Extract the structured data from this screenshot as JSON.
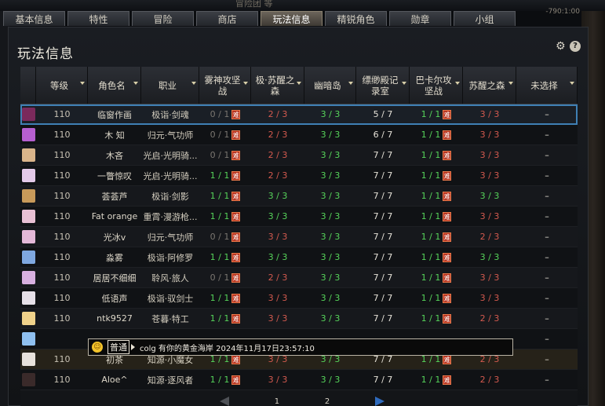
{
  "window": {
    "title": "冒险团 等",
    "clock": "-790:1:00"
  },
  "tabs": [
    {
      "label": "基本信息",
      "active": false
    },
    {
      "label": "特性",
      "active": false
    },
    {
      "label": "冒险",
      "active": false
    },
    {
      "label": "商店",
      "active": false
    },
    {
      "label": "玩法信息",
      "active": true
    },
    {
      "label": "精锐角色",
      "active": false
    },
    {
      "label": "勋章",
      "active": false
    },
    {
      "label": "小组",
      "active": false
    }
  ],
  "panel": {
    "title": "玩法信息",
    "settings_icon": "gear-icon",
    "help_icon": "help-icon",
    "help_label": "?"
  },
  "columns": [
    "等级",
    "角色名",
    "职业",
    "雾神攻坚战",
    "极·苏醒之森",
    "幽暗岛",
    "缥缈殿记录室",
    "巴卡尔攻坚战",
    "苏醒之森",
    "未选择"
  ],
  "hard_badge": "难",
  "rows": [
    {
      "avatar_color": "#7a2a5c",
      "level": "110",
      "name": "临窗作画",
      "job": "极诣·剑魂",
      "c1": "0 / 1",
      "c1c": "dim",
      "c1h": true,
      "c2": "2 / 3",
      "c2c": "red",
      "c3": "3 / 3",
      "c3c": "grn",
      "c4": "5 / 7",
      "c4c": "wht",
      "c5": "1 / 1",
      "c5c": "grn",
      "c5h": true,
      "c6": "3 / 3",
      "c6c": "red",
      "c7": "–",
      "selected": true
    },
    {
      "avatar_color": "#b65fd0",
      "level": "110",
      "name": "木  知",
      "job": "归元·气功师",
      "c1": "0 / 1",
      "c1c": "dim",
      "c1h": true,
      "c2": "2 / 3",
      "c2c": "red",
      "c3": "3 / 3",
      "c3c": "grn",
      "c4": "6 / 7",
      "c4c": "wht",
      "c5": "1 / 1",
      "c5c": "grn",
      "c5h": true,
      "c6": "3 / 3",
      "c6c": "red",
      "c7": "–"
    },
    {
      "avatar_color": "#d9b48a",
      "level": "110",
      "name": "木吝",
      "job": "光启·光明骑...",
      "c1": "0 / 1",
      "c1c": "dim",
      "c1h": true,
      "c2": "2 / 3",
      "c2c": "red",
      "c3": "3 / 3",
      "c3c": "grn",
      "c4": "7 / 7",
      "c4c": "wht",
      "c5": "1 / 1",
      "c5c": "grn",
      "c5h": true,
      "c6": "3 / 3",
      "c6c": "red",
      "c7": "–"
    },
    {
      "avatar_color": "#e3c9e8",
      "level": "110",
      "name": "一瞥惊叹",
      "job": "光启·光明骑...",
      "c1": "1 / 1",
      "c1c": "grn",
      "c1h": true,
      "c2": "2 / 3",
      "c2c": "red",
      "c3": "3 / 3",
      "c3c": "grn",
      "c4": "7 / 7",
      "c4c": "wht",
      "c5": "1 / 1",
      "c5c": "grn",
      "c5h": true,
      "c6": "3 / 3",
      "c6c": "red",
      "c7": "–"
    },
    {
      "avatar_color": "#c89a5a",
      "level": "110",
      "name": "荟荟芦",
      "job": "极诣·剑影",
      "c1": "1 / 1",
      "c1c": "grn",
      "c1h": true,
      "c2": "3 / 3",
      "c2c": "grn",
      "c3": "3 / 3",
      "c3c": "grn",
      "c4": "7 / 7",
      "c4c": "wht",
      "c5": "1 / 1",
      "c5c": "grn",
      "c5h": true,
      "c6": "3 / 3",
      "c6c": "grn",
      "c7": "–"
    },
    {
      "avatar_color": "#e8c0d4",
      "level": "110",
      "name": "Fat orange",
      "job": "重霄·漫游枪...",
      "c1": "1 / 1",
      "c1c": "grn",
      "c1h": true,
      "c2": "3 / 3",
      "c2c": "grn",
      "c3": "3 / 3",
      "c3c": "grn",
      "c4": "7 / 7",
      "c4c": "wht",
      "c5": "1 / 1",
      "c5c": "grn",
      "c5h": true,
      "c6": "3 / 3",
      "c6c": "red",
      "c7": "–"
    },
    {
      "avatar_color": "#e4b8d8",
      "level": "110",
      "name": "光冰v",
      "job": "归元·气功师",
      "c1": "0 / 1",
      "c1c": "dim",
      "c1h": true,
      "c2": "3 / 3",
      "c2c": "red",
      "c3": "3 / 3",
      "c3c": "grn",
      "c4": "7 / 7",
      "c4c": "wht",
      "c5": "1 / 1",
      "c5c": "grn",
      "c5h": true,
      "c6": "2 / 3",
      "c6c": "red",
      "c7": "–"
    },
    {
      "avatar_color": "#7fa8e0",
      "level": "110",
      "name": "淼雾",
      "job": "极诣·阿修罗",
      "c1": "1 / 1",
      "c1c": "grn",
      "c1h": true,
      "c2": "3 / 3",
      "c2c": "grn",
      "c3": "3 / 3",
      "c3c": "grn",
      "c4": "7 / 7",
      "c4c": "wht",
      "c5": "1 / 1",
      "c5c": "grn",
      "c5h": true,
      "c6": "3 / 3",
      "c6c": "grn",
      "c7": "–"
    },
    {
      "avatar_color": "#d8b0e0",
      "level": "110",
      "name": "居居不细细",
      "job": "聆风·旅人",
      "c1": "0 / 1",
      "c1c": "dim",
      "c1h": true,
      "c2": "2 / 3",
      "c2c": "red",
      "c3": "3 / 3",
      "c3c": "grn",
      "c4": "7 / 7",
      "c4c": "wht",
      "c5": "1 / 1",
      "c5c": "grn",
      "c5h": true,
      "c6": "3 / 3",
      "c6c": "red",
      "c7": "–"
    },
    {
      "avatar_color": "#e6e0e8",
      "level": "110",
      "name": "低语声",
      "job": "极诣·驭剑士",
      "c1": "1 / 1",
      "c1c": "grn",
      "c1h": true,
      "c2": "3 / 3",
      "c2c": "red",
      "c3": "3 / 3",
      "c3c": "grn",
      "c4": "7 / 7",
      "c4c": "wht",
      "c5": "1 / 1",
      "c5c": "grn",
      "c5h": true,
      "c6": "3 / 3",
      "c6c": "red",
      "c7": "–"
    },
    {
      "avatar_color": "#f0d28a",
      "level": "110",
      "name": "ntk9527",
      "job": "苍暮·特工",
      "c1": "1 / 1",
      "c1c": "grn",
      "c1h": true,
      "c2": "3 / 3",
      "c2c": "red",
      "c3": "3 / 3",
      "c3c": "grn",
      "c4": "7 / 7",
      "c4c": "wht",
      "c5": "1 / 1",
      "c5c": "grn",
      "c5h": true,
      "c6": "2 / 3",
      "c6c": "red",
      "c7": "–"
    },
    {
      "avatar_color": "#8fc0f0",
      "level": "",
      "name": "",
      "job": "",
      "c1": "",
      "c1c": "grn",
      "c1h": false,
      "c2": "",
      "c2c": "red",
      "c3": "",
      "c3c": "grn",
      "c4": "",
      "c4c": "wht",
      "c5": "",
      "c5c": "grn",
      "c5h": false,
      "c6": "",
      "c6c": "red",
      "c7": "–"
    },
    {
      "avatar_color": "#e8e2dc",
      "level": "110",
      "name": "初茶",
      "job": "知源·小魔女",
      "c1": "1 / 1",
      "c1c": "grn",
      "c1h": true,
      "c2": "3 / 3",
      "c2c": "red",
      "c3": "3 / 3",
      "c3c": "grn",
      "c4": "7 / 7",
      "c4c": "wht",
      "c5": "1 / 1",
      "c5c": "grn",
      "c5h": true,
      "c6": "2 / 3",
      "c6c": "red",
      "c7": "–",
      "highlight": true
    },
    {
      "avatar_color": "#3a2a2a",
      "level": "110",
      "name": "Aloe^",
      "job": "知源·逐风者",
      "c1": "1 / 1",
      "c1c": "grn",
      "c1h": true,
      "c2": "3 / 3",
      "c2c": "red",
      "c3": "3 / 3",
      "c3c": "grn",
      "c4": "7 / 7",
      "c4c": "wht",
      "c5": "1 / 1",
      "c5c": "grn",
      "c5h": true,
      "c6": "2 / 3",
      "c6c": "red",
      "c7": "–"
    }
  ],
  "tooltip": {
    "channel": "普通",
    "message": "colg 有你的黄金海岸 2024年11月17日23:57:10"
  },
  "pager": {
    "pages": [
      "1",
      "2"
    ]
  }
}
